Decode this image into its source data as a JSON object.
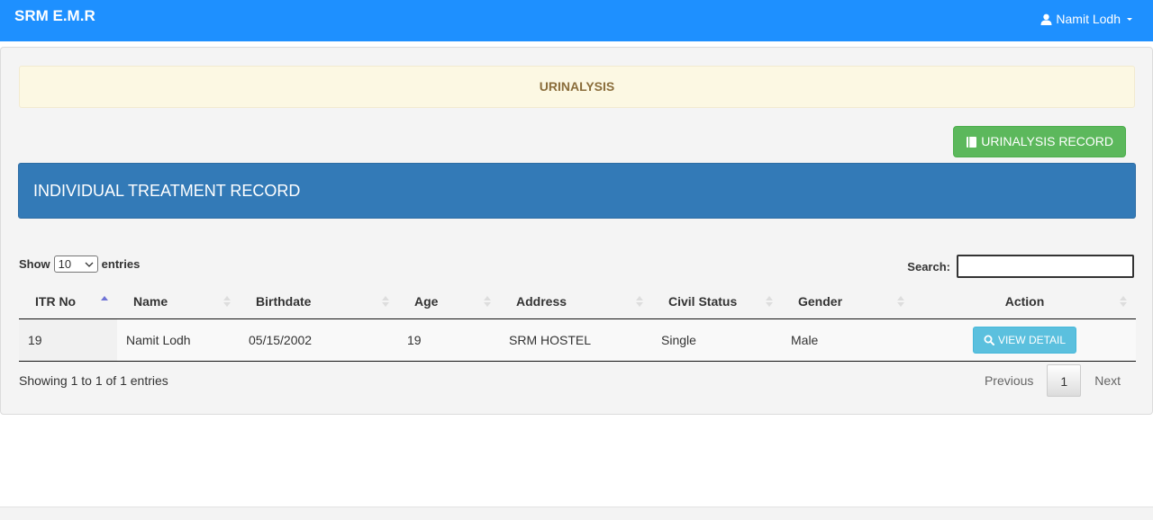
{
  "navbar": {
    "brand": "SRM E.M.R",
    "user_name": "Namit Lodh"
  },
  "banner": {
    "title": "URINALYSIS"
  },
  "actions": {
    "record_button": "URINALYSIS RECORD"
  },
  "section": {
    "title": "INDIVIDUAL TREATMENT RECORD"
  },
  "table_controls": {
    "show_label": "Show",
    "page_size": "10",
    "entries_label": "entries",
    "search_label": "Search:",
    "search_value": ""
  },
  "table": {
    "columns": [
      "ITR No",
      "Name",
      "Birthdate",
      "Age",
      "Address",
      "Civil Status",
      "Gender",
      "Action"
    ],
    "rows": [
      {
        "itr_no": "19",
        "name": "Namit Lodh",
        "birthdate": "05/15/2002",
        "age": "19",
        "address": "SRM HOSTEL",
        "civil_status": "Single",
        "gender": "Male",
        "action_label": "VIEW DETAIL"
      }
    ]
  },
  "footer": {
    "info": "Showing 1 to 1 of 1 entries",
    "previous": "Previous",
    "current_page": "1",
    "next": "Next"
  },
  "colors": {
    "navbar": "#1e90ff",
    "section_header": "#337ab7",
    "record_button": "#5cb85c",
    "view_button": "#5bc0de",
    "banner": "#fcf8e3"
  },
  "icons": {
    "user": "user-icon",
    "caret": "caret-down-icon",
    "book": "book-icon",
    "search": "search-icon"
  }
}
